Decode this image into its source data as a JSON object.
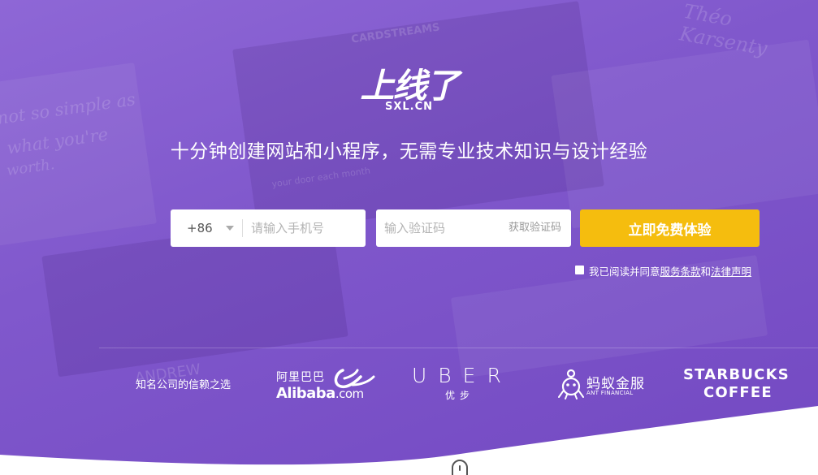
{
  "logo": {
    "title": "上线了",
    "sub": "SXL.CN"
  },
  "tagline": "十分钟创建网站和小程序，无需专业技术知识与设计经验",
  "form": {
    "country_code": "+86",
    "phone_placeholder": "请输入手机号",
    "code_placeholder": "输入验证码",
    "get_code_label": "获取验证码",
    "submit_label": "立即免费体验"
  },
  "agreement": {
    "prefix": "我已阅读并同意",
    "terms_link": "服务条款",
    "middle": "和",
    "legal_link": "法律声明"
  },
  "trusted_by": "知名公司的信赖之选",
  "brands": {
    "alibaba_cn": "阿里巴巴",
    "alibaba_en": "Alibaba",
    "alibaba_suffix": ".com",
    "uber_en": "UBER",
    "uber_cn": "优步",
    "ant_cn": "蚂蚁金服",
    "ant_en": "ANT FINANCIAL",
    "starbucks_1": "STARBUCKS",
    "starbucks_2": "COFFEE"
  },
  "background_text": {
    "script": "Théo Karsenty",
    "cardstreams": "CARDSTREAMS",
    "quote1": "not so simple as",
    "quote2": "what you're",
    "quote3": "worth.",
    "andrew": "ANDREW",
    "door": "your door each month"
  },
  "colors": {
    "hero": "#8058cc",
    "cta": "#f5bd0e"
  },
  "icons": [
    "dropdown-arrow-icon",
    "alibaba-logo-icon",
    "ant-logo-icon",
    "scroll-mouse-icon"
  ]
}
